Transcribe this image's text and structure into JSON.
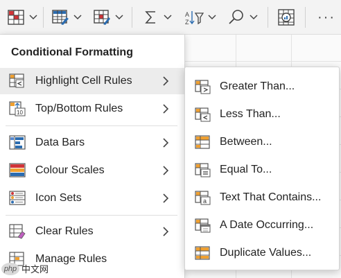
{
  "menu": {
    "title": "Conditional Formatting",
    "items": [
      {
        "label": "Highlight Cell Rules",
        "icon": "highlight-cell-rules-icon",
        "has_submenu": true,
        "active": true
      },
      {
        "label": "Top/Bottom Rules",
        "icon": "top-bottom-rules-icon",
        "has_submenu": true
      },
      {
        "label": "Data Bars",
        "icon": "data-bars-icon",
        "has_submenu": true
      },
      {
        "label": "Colour Scales",
        "icon": "colour-scales-icon",
        "has_submenu": true
      },
      {
        "label": "Icon Sets",
        "icon": "icon-sets-icon",
        "has_submenu": true
      },
      {
        "label": "Clear Rules",
        "icon": "clear-rules-icon",
        "has_submenu": true
      },
      {
        "label": "Manage Rules",
        "icon": "manage-rules-icon",
        "has_submenu": false
      }
    ]
  },
  "submenu": {
    "items": [
      {
        "label": "Greater Than...",
        "icon": "greater-than-icon"
      },
      {
        "label": "Less Than...",
        "icon": "less-than-icon"
      },
      {
        "label": "Between...",
        "icon": "between-icon"
      },
      {
        "label": "Equal To...",
        "icon": "equal-to-icon"
      },
      {
        "label": "Text That Contains...",
        "icon": "text-contains-icon"
      },
      {
        "label": "A Date Occurring...",
        "icon": "date-occurring-icon"
      },
      {
        "label": "Duplicate Values...",
        "icon": "duplicate-values-icon"
      }
    ]
  },
  "toolbar": {
    "more_label": "···"
  },
  "watermark": {
    "badge": "php",
    "text": "中文网"
  },
  "colors": {
    "accent_red": "#d13438",
    "accent_blue": "#2b6cb0",
    "accent_orange": "#f0a030",
    "hover": "#ececec"
  }
}
